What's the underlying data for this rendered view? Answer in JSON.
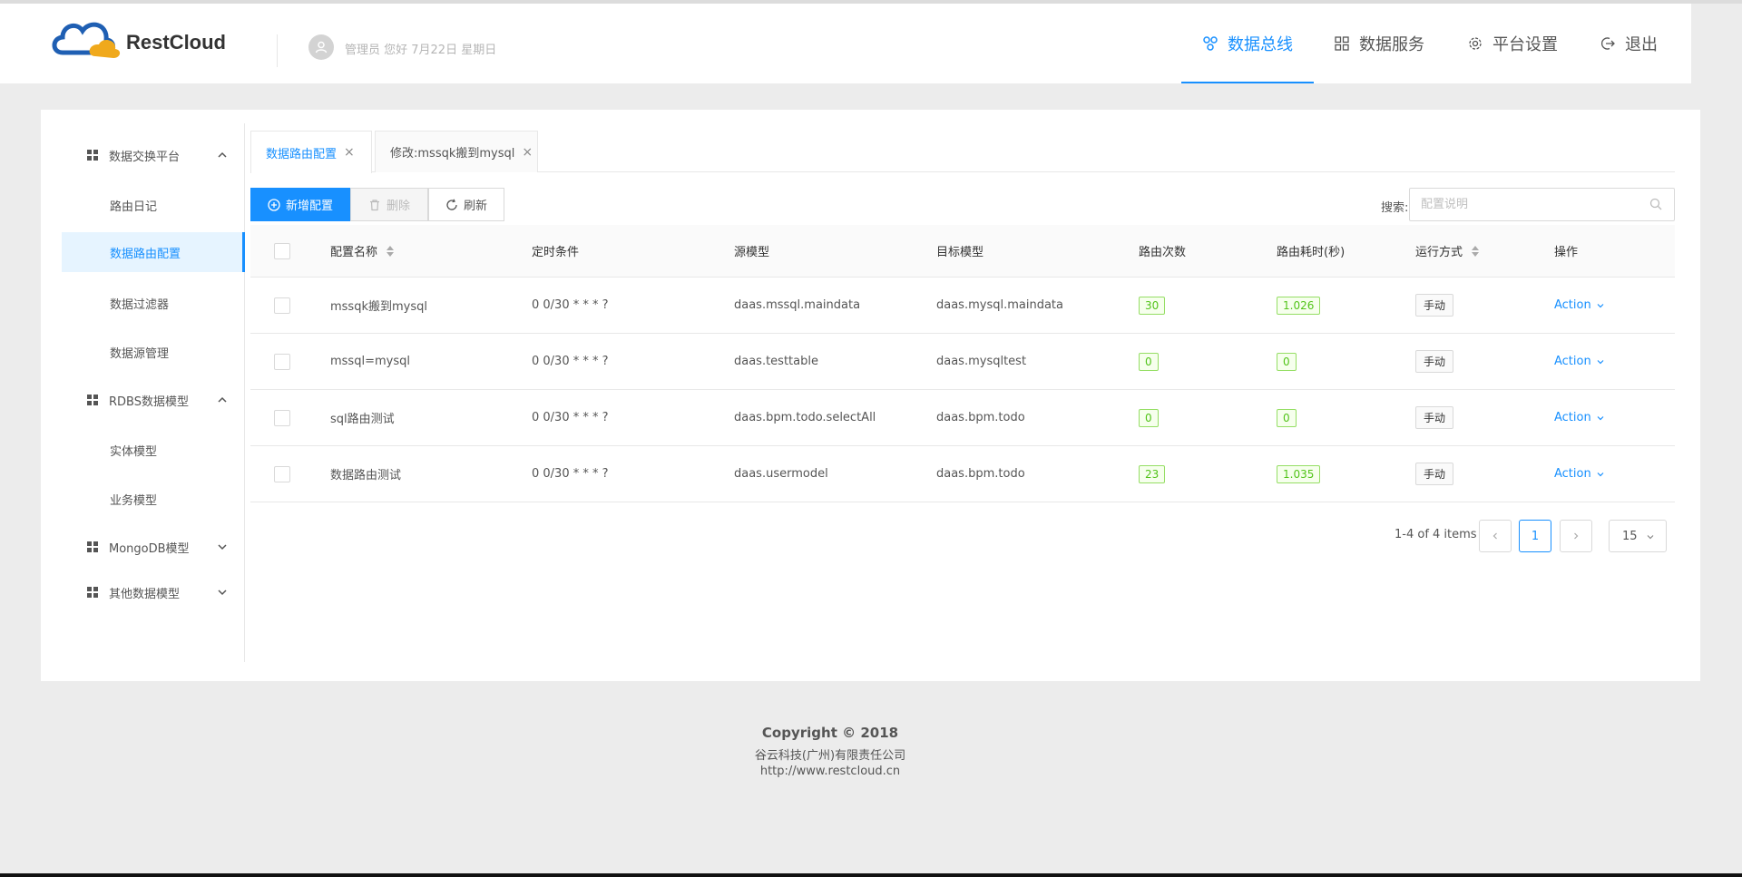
{
  "header": {
    "logo_text": "RestCloud",
    "welcome": "管理员 您好 7月22日 星期日",
    "nav": [
      {
        "label": "数据总线",
        "icon": "cluster-icon",
        "active": true
      },
      {
        "label": "数据服务",
        "icon": "apps-icon"
      },
      {
        "label": "平台设置",
        "icon": "gear-icon"
      },
      {
        "label": "退出",
        "icon": "logout-icon"
      }
    ]
  },
  "sidebar": {
    "groups": [
      {
        "label": "数据交换平台",
        "expanded": true,
        "items": [
          "路由日记",
          "数据路由配置",
          "数据过滤器",
          "数据源管理"
        ],
        "active_item": "数据路由配置"
      },
      {
        "label": "RDBS数据模型",
        "expanded": true,
        "items": [
          "实体模型",
          "业务模型"
        ]
      },
      {
        "label": "MongoDB模型",
        "expanded": false,
        "items": []
      },
      {
        "label": "其他数据模型",
        "expanded": false,
        "items": []
      }
    ]
  },
  "tabs": [
    {
      "label": "数据路由配置",
      "active": true
    },
    {
      "label": "修改:mssqk搬到mysql",
      "active": false
    }
  ],
  "toolbar": {
    "add_label": "新增配置",
    "delete_label": "删除",
    "refresh_label": "刷新",
    "search_label": "搜索:",
    "search_placeholder": "配置说明"
  },
  "table": {
    "columns": [
      "配置名称",
      "定时条件",
      "源模型",
      "目标模型",
      "路由次数",
      "路由耗时(秒)",
      "运行方式",
      "操作"
    ],
    "rows": [
      {
        "name": "mssqk搬到mysql",
        "schedule": "0 0/30 * * * ?",
        "source": "daas.mssql.maindata",
        "target": "daas.mysql.maindata",
        "count": "30",
        "time": "1.026",
        "mode": "手动",
        "action": "Action"
      },
      {
        "name": "mssql=mysql",
        "schedule": "0 0/30 * * * ?",
        "source": "daas.testtable",
        "target": "daas.mysqltest",
        "count": "0",
        "time": "0",
        "mode": "手动",
        "action": "Action"
      },
      {
        "name": "sql路由测试",
        "schedule": "0 0/30 * * * ?",
        "source": "daas.bpm.todo.selectAll",
        "target": "daas.bpm.todo",
        "count": "0",
        "time": "0",
        "mode": "手动",
        "action": "Action"
      },
      {
        "name": "数据路由测试",
        "schedule": "0 0/30 * * * ?",
        "source": "daas.usermodel",
        "target": "daas.bpm.todo",
        "count": "23",
        "time": "1.035",
        "mode": "手动",
        "action": "Action"
      }
    ]
  },
  "pagination": {
    "total_text": "1-4 of 4 items",
    "current_page": "1",
    "page_size": "15"
  },
  "footer": {
    "copyright": "Copyright © 2018",
    "company": "谷云科技(广州)有限责任公司",
    "url": "http://www.restcloud.cn"
  },
  "colors": {
    "primary": "#1890ff",
    "success_border": "#95de64",
    "success_text": "#52c41a"
  }
}
